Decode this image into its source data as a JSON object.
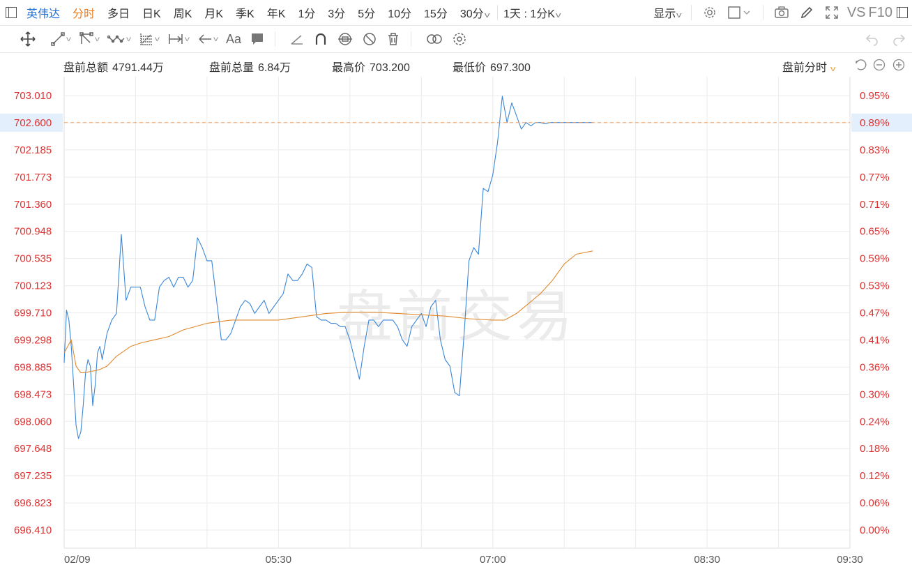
{
  "toolbar": {
    "stock_name": "英伟达",
    "tabs": [
      "分时",
      "多日",
      "日K",
      "周K",
      "月K",
      "季K",
      "年K",
      "1分",
      "3分",
      "5分",
      "10分",
      "15分",
      "30分"
    ],
    "active_tab": "分时",
    "period_select": "1天 : 1分K",
    "display_label": "显示",
    "vs_label": "VS",
    "f10_label": "F10"
  },
  "stats": {
    "amount_label": "盘前总额",
    "amount_value": "4791.44万",
    "volume_label": "盘前总量",
    "volume_value": "6.84万",
    "high_label": "最高价",
    "high_value": "703.200",
    "low_label": "最低价",
    "low_value": "697.300",
    "mode_label": "盘前分时"
  },
  "chart_data": {
    "type": "line",
    "watermark": "盘前交易",
    "y_ticks": [
      "703.010",
      "702.600",
      "702.185",
      "701.773",
      "701.360",
      "700.948",
      "700.535",
      "700.123",
      "699.710",
      "699.298",
      "698.885",
      "698.473",
      "698.060",
      "697.648",
      "697.235",
      "696.823",
      "696.410"
    ],
    "pct_ticks": [
      "0.95%",
      "0.89%",
      "0.83%",
      "0.77%",
      "0.71%",
      "0.65%",
      "0.59%",
      "0.53%",
      "0.47%",
      "0.41%",
      "0.36%",
      "0.30%",
      "0.24%",
      "0.18%",
      "0.12%",
      "0.06%",
      "0.00%"
    ],
    "ylim": [
      696.41,
      703.01
    ],
    "x_tick_labels": [
      {
        "label": "02/09",
        "minute": 0
      },
      {
        "label": "05:30",
        "minute": 90
      },
      {
        "label": "07:00",
        "minute": 180
      },
      {
        "label": "08:30",
        "minute": 270
      },
      {
        "label": "09:30",
        "minute": 330
      }
    ],
    "x_range_minutes": [
      0,
      330
    ],
    "current_price": "702.600",
    "current_pct": "0.89%",
    "colors": {
      "price": "#3a86d8",
      "avg": "#e08a2e",
      "ref_line": "#f0a060",
      "axis_text": "#e03030",
      "x_text": "#555",
      "grid": "#ececec"
    },
    "series": [
      {
        "kind": "price",
        "x": [
          0,
          1,
          2,
          3,
          4,
          5,
          6,
          7,
          8,
          9,
          10,
          11,
          12,
          13,
          14,
          15,
          16,
          18,
          20,
          22,
          24,
          26,
          28,
          30,
          32,
          34,
          36,
          38,
          40,
          42,
          44,
          46,
          48,
          50,
          52,
          54,
          56,
          58,
          60,
          62,
          64,
          66,
          68,
          70,
          72,
          74,
          76,
          78,
          80,
          82,
          84,
          86,
          88,
          90,
          92,
          94,
          96,
          98,
          100,
          102,
          104,
          106,
          108,
          110,
          112,
          114,
          116,
          118,
          120,
          122,
          124,
          126,
          128,
          130,
          132,
          134,
          136,
          138,
          140,
          142,
          144,
          146,
          148,
          150,
          152,
          154,
          156,
          158,
          160,
          162,
          164,
          166,
          168,
          170,
          172,
          174,
          176,
          178,
          180,
          182,
          184,
          186,
          188,
          190,
          192,
          194,
          196,
          198,
          200,
          202,
          204,
          206,
          208,
          210,
          212,
          214,
          216,
          218,
          220,
          222
        ],
        "y": [
          698.95,
          699.75,
          699.6,
          699.2,
          698.6,
          698.0,
          697.8,
          697.9,
          698.3,
          698.8,
          699.0,
          698.9,
          698.3,
          698.6,
          699.1,
          699.2,
          699.0,
          699.4,
          699.6,
          699.7,
          700.9,
          699.9,
          700.1,
          700.1,
          700.1,
          699.8,
          699.6,
          699.6,
          700.1,
          700.2,
          700.25,
          700.1,
          700.25,
          700.25,
          700.1,
          700.2,
          700.85,
          700.7,
          700.5,
          700.5,
          699.9,
          699.3,
          699.3,
          699.4,
          699.6,
          699.8,
          699.9,
          699.85,
          699.7,
          699.8,
          699.9,
          699.7,
          699.8,
          699.9,
          700.0,
          700.3,
          700.2,
          700.2,
          700.3,
          700.45,
          700.4,
          699.65,
          699.6,
          699.6,
          699.55,
          699.55,
          699.5,
          699.5,
          699.3,
          699.0,
          698.7,
          699.2,
          699.6,
          699.6,
          699.5,
          699.6,
          699.6,
          699.6,
          699.5,
          699.3,
          699.2,
          699.5,
          699.6,
          699.7,
          699.5,
          699.8,
          699.9,
          699.3,
          699.0,
          698.9,
          698.5,
          698.45,
          699.4,
          700.5,
          700.7,
          700.6,
          701.6,
          701.55,
          701.8,
          702.3,
          703.0,
          702.6,
          702.9,
          702.7,
          702.5,
          702.6,
          702.55,
          702.6,
          702.6,
          702.58,
          702.6,
          702.6,
          702.6,
          702.6,
          702.6,
          702.6,
          702.6,
          702.6,
          702.6,
          702.6
        ]
      },
      {
        "kind": "avg",
        "x": [
          0,
          3,
          5,
          7,
          9,
          11,
          13,
          15,
          18,
          22,
          28,
          32,
          38,
          44,
          50,
          60,
          70,
          80,
          90,
          100,
          110,
          120,
          130,
          140,
          150,
          160,
          170,
          180,
          185,
          190,
          195,
          200,
          205,
          210,
          215,
          222
        ],
        "y": [
          699.1,
          699.3,
          698.9,
          698.8,
          698.8,
          698.82,
          698.83,
          698.85,
          698.9,
          699.05,
          699.2,
          699.25,
          699.3,
          699.35,
          699.45,
          699.55,
          699.6,
          699.6,
          699.6,
          699.65,
          699.7,
          699.72,
          699.72,
          699.7,
          699.68,
          699.66,
          699.62,
          699.6,
          699.6,
          699.7,
          699.85,
          700.0,
          700.2,
          700.45,
          700.6,
          700.65
        ]
      }
    ]
  }
}
